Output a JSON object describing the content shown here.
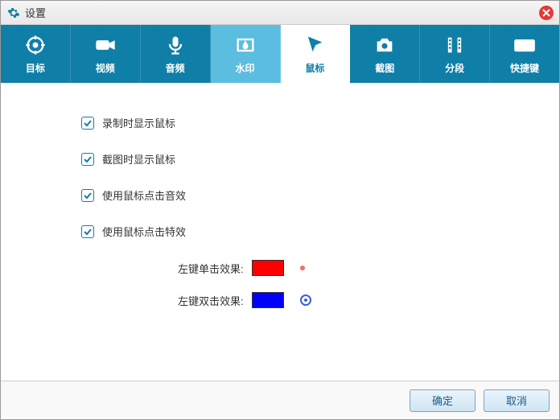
{
  "window": {
    "title": "设置"
  },
  "tabs": [
    {
      "label": "目标",
      "icon": "target-icon"
    },
    {
      "label": "视频",
      "icon": "video-icon"
    },
    {
      "label": "音频",
      "icon": "audio-icon"
    },
    {
      "label": "水印",
      "icon": "watermark-icon"
    },
    {
      "label": "鼠标",
      "icon": "cursor-icon"
    },
    {
      "label": "截图",
      "icon": "camera-icon"
    },
    {
      "label": "分段",
      "icon": "segment-icon"
    },
    {
      "label": "快捷键",
      "icon": "keyboard-icon"
    }
  ],
  "checkboxes": [
    {
      "label": "录制时显示鼠标",
      "checked": true
    },
    {
      "label": "截图时显示鼠标",
      "checked": true
    },
    {
      "label": "使用鼠标点击音效",
      "checked": true
    },
    {
      "label": "使用鼠标点击特效",
      "checked": true
    }
  ],
  "colorSettings": {
    "singleClick": {
      "label": "左键单击效果:",
      "color": "#ff0000"
    },
    "doubleClick": {
      "label": "左键双击效果:",
      "color": "#0000ff"
    }
  },
  "buttons": {
    "ok": "确定",
    "cancel": "取消"
  }
}
